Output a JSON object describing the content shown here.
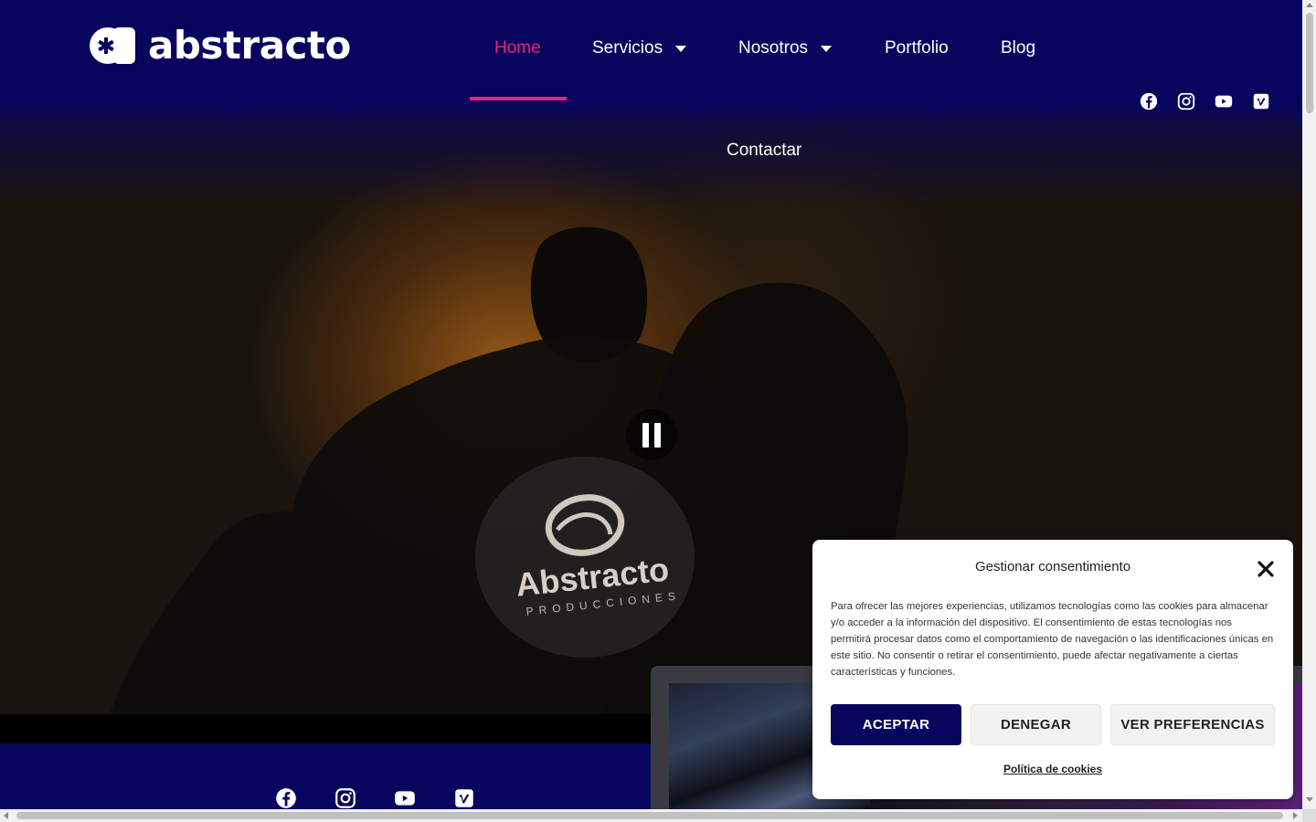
{
  "brand": {
    "name": "abstracto",
    "color_primary": "#08055e",
    "color_accent": "#e8227e"
  },
  "nav": {
    "items": [
      {
        "label": "Home",
        "active": true
      },
      {
        "label": "Servicios",
        "has_dropdown": true
      },
      {
        "label": "Nosotros",
        "has_dropdown": true
      },
      {
        "label": "Portfolio"
      },
      {
        "label": "Blog"
      }
    ],
    "contact_label": "Contactar"
  },
  "social": {
    "icons": [
      "facebook-icon",
      "instagram-icon",
      "youtube-icon",
      "vimeo-icon"
    ]
  },
  "hero": {
    "video_state": "playing",
    "control_icon": "pause-icon",
    "shirt_logo": {
      "line1": "Abstracto",
      "line2": "PRODUCCIONES"
    }
  },
  "cookie": {
    "title": "Gestionar consentimiento",
    "body": "Para ofrecer las mejores experiencias, utilizamos tecnologías como las cookies para almacenar y/o acceder a la información del dispositivo. El consentimiento de estas tecnologías nos permitirá procesar datos como el comportamiento de navegación o las identificaciones únicas en este sitio. No consentir o retirar el consentimiento, puede afectar negativamente a ciertas características y funciones.",
    "accept_label": "ACEPTAR",
    "deny_label": "DENEGAR",
    "prefs_label": "VER PREFERENCIAS",
    "policy_label": "Política de cookies"
  }
}
